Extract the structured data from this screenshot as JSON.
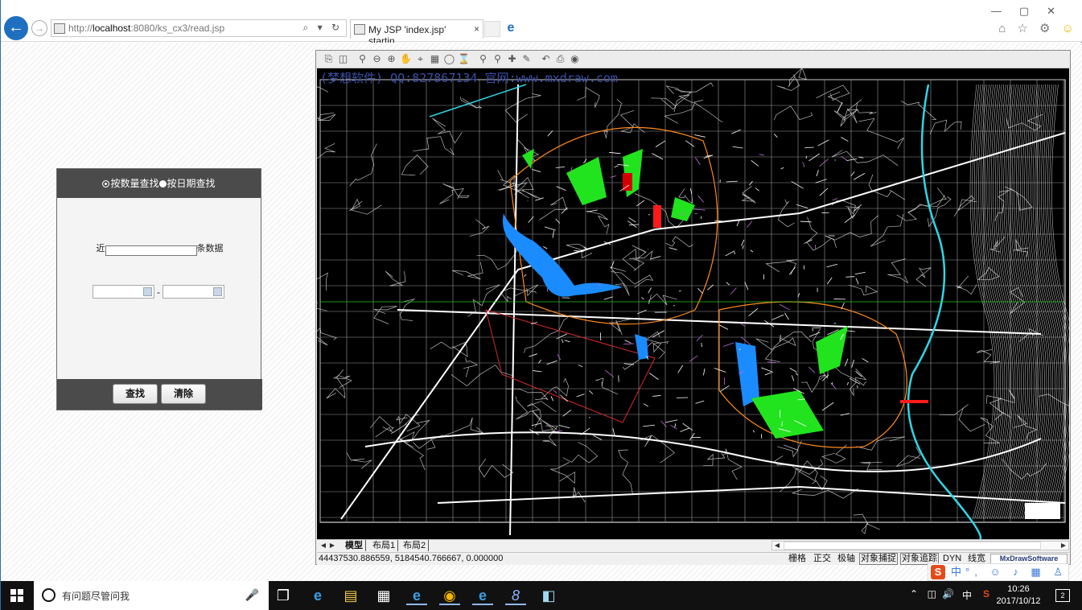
{
  "browser": {
    "url_scheme": "http://",
    "url_host": "localhost",
    "url_rest": ":8080/ks_cx3/read.jsp",
    "address_tools": "⌕ ▾ ↻",
    "tab_title": "My JSP 'index.jsp' startin...",
    "tab_close": "×",
    "window_controls": "—▢✕",
    "right_tools": [
      "⌂",
      "☆",
      "⚙",
      "☺"
    ]
  },
  "form": {
    "radio1_label": "按数量查找",
    "radio2_label": "按日期查找",
    "count_prefix": "近",
    "count_suffix": "条数据",
    "count_value": "",
    "date_sep": "-",
    "date_from": "",
    "date_to": "",
    "search_button": "查找",
    "clear_button": "清除"
  },
  "cad": {
    "watermark": "(梦想软件) QQ:827867134 官网:www.mxdraw.com",
    "layout_tabs": [
      "模型",
      "布局1",
      "布局2"
    ],
    "coordinates": "44437530.886559,  5184540.766667,  0.000000",
    "status_items": [
      {
        "label": "栅格",
        "active": false
      },
      {
        "label": "正交",
        "active": false
      },
      {
        "label": "极轴",
        "active": false
      },
      {
        "label": "对象捕捉",
        "active": true
      },
      {
        "label": "对象追踪",
        "active": true
      },
      {
        "label": "DYN",
        "active": false
      },
      {
        "label": "线宽",
        "active": false
      }
    ],
    "brand": "MxDrawSoftware",
    "colors": {
      "background": "#000000",
      "water": "#1a8cff",
      "vegetation": "#22e41e",
      "river": "#2fd6e6",
      "roads": "#ffffff",
      "accent": "#ff8a1e"
    }
  },
  "ime": {
    "logo": "S",
    "mode": "中",
    "icons": "°, ☺ ♪ ▦ ♙ ⬆ ✎"
  },
  "taskbar": {
    "search_placeholder": "有问题尽管问我",
    "ime_lang": "中",
    "time": "10:26",
    "date": "2017/10/12",
    "notifications": "2"
  }
}
